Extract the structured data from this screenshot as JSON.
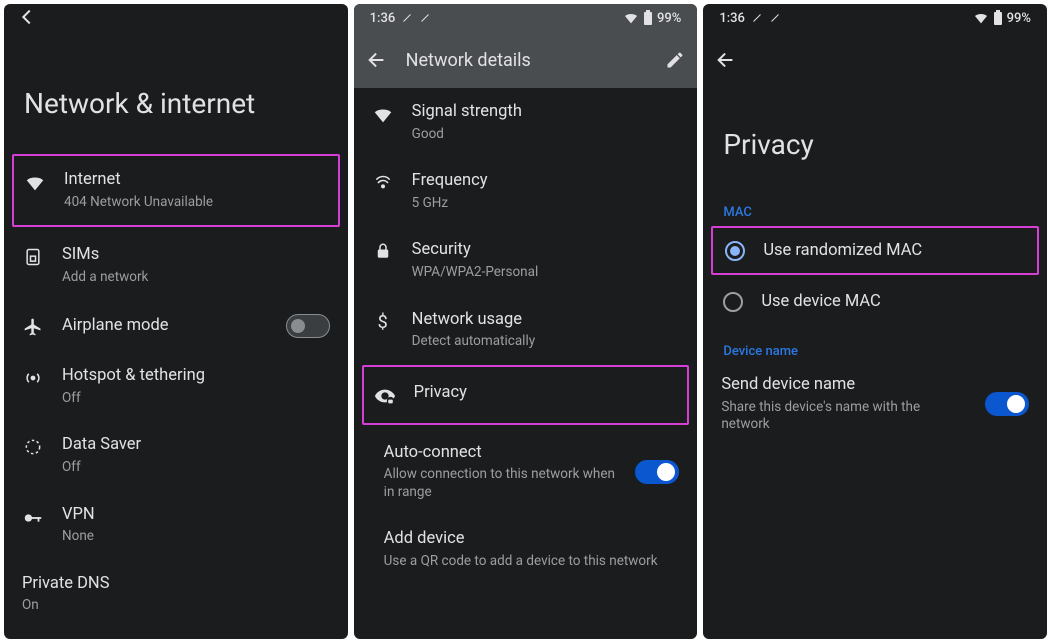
{
  "status": {
    "time": "1:36",
    "battery": "99%"
  },
  "panel1": {
    "title": "Network & internet",
    "items": [
      {
        "title": "Internet",
        "sub": "404 Network Unavailable"
      },
      {
        "title": "SIMs",
        "sub": "Add a network"
      },
      {
        "title": "Airplane mode"
      },
      {
        "title": "Hotspot & tethering",
        "sub": "Off"
      },
      {
        "title": "Data Saver",
        "sub": "Off"
      },
      {
        "title": "VPN",
        "sub": "None"
      },
      {
        "title": "Private DNS",
        "sub": "On"
      }
    ]
  },
  "panel2": {
    "header": "Network details",
    "items": [
      {
        "title": "Signal strength",
        "sub": "Good"
      },
      {
        "title": "Frequency",
        "sub": "5 GHz"
      },
      {
        "title": "Security",
        "sub": "WPA/WPA2-Personal"
      },
      {
        "title": "Network usage",
        "sub": "Detect automatically"
      },
      {
        "title": "Privacy"
      },
      {
        "title": "Auto-connect",
        "sub": "Allow connection to this network when in range"
      },
      {
        "title": "Add device",
        "sub": "Use a QR code to add a device to this network"
      }
    ]
  },
  "panel3": {
    "title": "Privacy",
    "sections": {
      "mac": {
        "label": "MAC",
        "opt1": "Use randomized MAC",
        "opt2": "Use device MAC"
      },
      "device": {
        "label": "Device name",
        "item": {
          "title": "Send device name",
          "sub": "Share this device's name with the network"
        }
      }
    }
  }
}
